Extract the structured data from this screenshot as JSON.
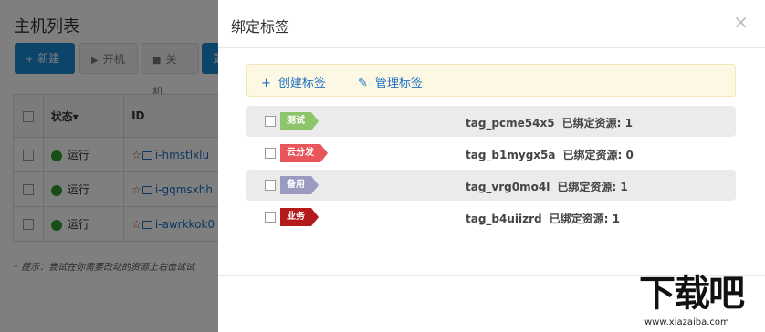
{
  "background": {
    "title": "主机列表",
    "buttons": {
      "new": "新建",
      "start": "开机",
      "stop": "关机",
      "more": "更"
    },
    "table": {
      "headers": {
        "status": "状态",
        "id": "ID"
      },
      "rows": [
        {
          "status": "运行",
          "id": "i-hmstlxlu"
        },
        {
          "status": "运行",
          "id": "i-gqmsxhh"
        },
        {
          "status": "运行",
          "id": "i-awrkkok0"
        }
      ]
    },
    "hint": "* 提示：尝试在你需要改动的资源上右击试试"
  },
  "modal": {
    "title": "绑定标签",
    "close": "×",
    "toolbar": {
      "create": "创建标签",
      "manage": "管理标签"
    },
    "tags": [
      {
        "label": "测试",
        "color": "#8dc56b",
        "name": "tag_pcme54x5",
        "bound_label": "已绑定资源:",
        "bound_count": "1"
      },
      {
        "label": "云分发",
        "color": "#e8555a",
        "name": "tag_b1mygx5a",
        "bound_label": "已绑定资源:",
        "bound_count": "0"
      },
      {
        "label": "备用",
        "color": "#9b9bc2",
        "name": "tag_vrg0mo4l",
        "bound_label": "已绑定资源:",
        "bound_count": "1"
      },
      {
        "label": "业务",
        "color": "#b41a1a",
        "name": "tag_b4uiizrd",
        "bound_label": "已绑定资源:",
        "bound_count": "1"
      }
    ]
  },
  "watermark": {
    "text": "下载吧",
    "url": "www.xiazaiba.com"
  }
}
